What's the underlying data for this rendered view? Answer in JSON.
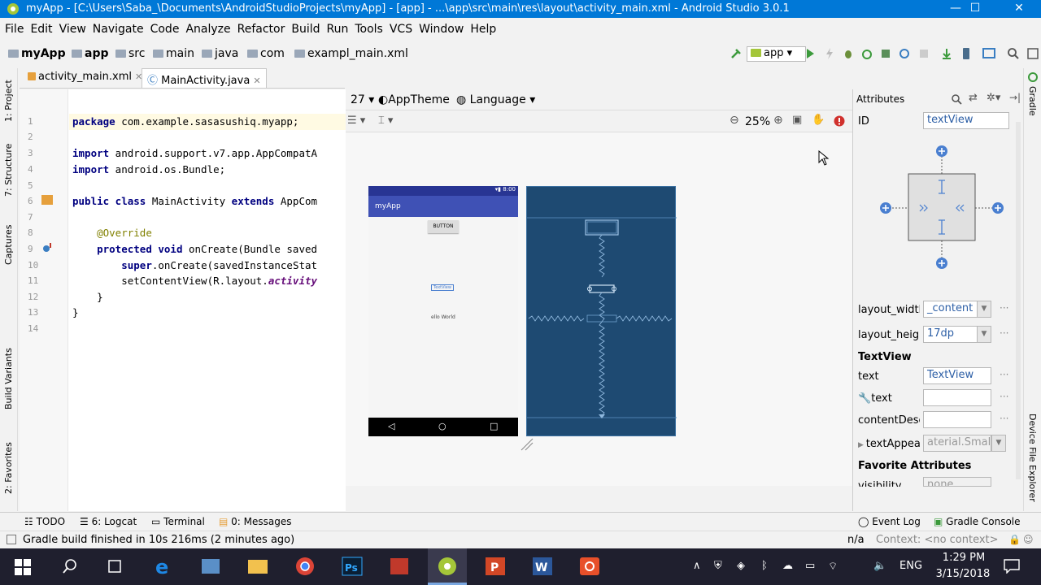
{
  "window": {
    "title": "myApp - [C:\\Users\\Saba_\\Documents\\AndroidStudioProjects\\myApp] - [app] - ...\\app\\src\\main\\res\\layout\\activity_main.xml - Android Studio 3.0.1",
    "minimize": "—",
    "maximize": "☐",
    "close": "✕"
  },
  "menu": [
    "File",
    "Edit",
    "View",
    "Navigate",
    "Code",
    "Analyze",
    "Refactor",
    "Build",
    "Run",
    "Tools",
    "VCS",
    "Window",
    "Help"
  ],
  "breadcrumb": [
    "myApp",
    "app",
    "src",
    "main",
    "java",
    "com",
    "exampl_main.xml"
  ],
  "run_config": "app",
  "tabs": [
    {
      "label": "activity_main.xml"
    },
    {
      "label": "MainActivity.java"
    }
  ],
  "left_tools": [
    "1: Project",
    "7: Structure",
    "Captures",
    "Build Variants",
    "2: Favorites"
  ],
  "right_tools": [
    "Gradle",
    "Device File Explorer"
  ],
  "code_lines": [
    {
      "n": "1",
      "text": "package com.example.sasasushiq.myapp;"
    },
    {
      "n": "2",
      "text": ""
    },
    {
      "n": "3",
      "text": "import android.support.v7.app.AppCompatA"
    },
    {
      "n": "4",
      "text": "import android.os.Bundle;"
    },
    {
      "n": "5",
      "text": ""
    },
    {
      "n": "6",
      "text": "public class MainActivity extends AppCom"
    },
    {
      "n": "7",
      "text": ""
    },
    {
      "n": "8",
      "text": "    @Override"
    },
    {
      "n": "9",
      "text": "    protected void onCreate(Bundle saved"
    },
    {
      "n": "10",
      "text": "        super.onCreate(savedInstanceStat"
    },
    {
      "n": "11",
      "text": "        setContentView(R.layout.activity"
    },
    {
      "n": "12",
      "text": "    }"
    },
    {
      "n": "13",
      "text": "}"
    },
    {
      "n": "14",
      "text": ""
    }
  ],
  "design": {
    "api": "27",
    "theme": "AppTheme",
    "language": "Language",
    "zoom": "25%"
  },
  "phone": {
    "status": "8:00",
    "app_title": "myApp",
    "button": "BUTTON",
    "textview": "TextView",
    "hello": "ello World",
    "nav_back": "◁",
    "nav_home": "○",
    "nav_recent": "□"
  },
  "attributes": {
    "header": "Attributes",
    "id_label": "ID",
    "id_value": "textView",
    "layout_width_label": "layout_width",
    "layout_width_value": "_content",
    "layout_height_label": "layout_heigh",
    "layout_height_value": "17dp",
    "section_textview": "TextView",
    "text_label": "text",
    "text_value": "TextView",
    "tools_text_label": "text",
    "content_desc_label": "contentDesc",
    "text_appearance_label": "textAppea",
    "text_appearance_value": "aterial.Small",
    "section_favorites": "Favorite Attributes",
    "visibility_label": "visibility",
    "visibility_value": "none"
  },
  "bottom_tools": {
    "todo": "TODO",
    "logcat": "6: Logcat",
    "terminal": "Terminal",
    "messages": "0: Messages",
    "event_log": "Event Log",
    "gradle_console": "Gradle Console"
  },
  "status": {
    "message": "Gradle build finished in 10s 216ms (2 minutes ago)",
    "position": "n/a",
    "context": "Context: <no context>"
  },
  "taskbar": {
    "lang": "ENG",
    "time": "1:29 PM",
    "date": "3/15/2018"
  },
  "colors": {
    "titlebar": "#0078d7",
    "blueprint": "#1e4a72",
    "appbar": "#3f51b5",
    "accent_text": "#2d5fa6"
  }
}
